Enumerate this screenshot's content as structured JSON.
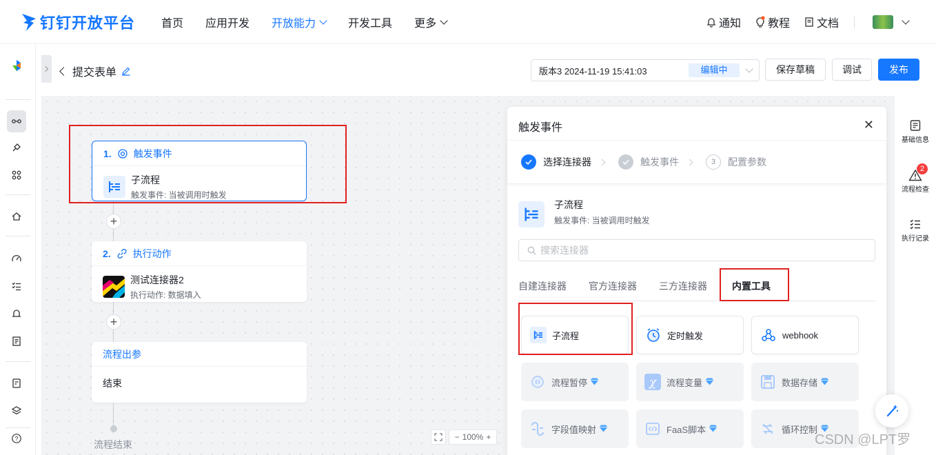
{
  "brand": {
    "name": "钉钉开放平台"
  },
  "nav": {
    "items": [
      {
        "label": "首页",
        "active": false,
        "has_menu": false
      },
      {
        "label": "应用开发",
        "active": false,
        "has_menu": false
      },
      {
        "label": "开放能力",
        "active": true,
        "has_menu": true
      },
      {
        "label": "开发工具",
        "active": false,
        "has_menu": false
      },
      {
        "label": "更多",
        "active": false,
        "has_menu": true
      }
    ],
    "notify": "通知",
    "tutorial": "教程",
    "docs": "文档"
  },
  "header": {
    "title": "提交表单",
    "version_text": "版本3 2024-11-19 15:41:03",
    "version_status": "编辑中",
    "save_draft": "保存草稿",
    "debug": "调试",
    "publish": "发布"
  },
  "flow": {
    "trigger": {
      "index": "1.",
      "label": "触发事件",
      "title": "子流程",
      "sub": "触发事件: 当被调用时触发"
    },
    "action": {
      "index": "2.",
      "label": "执行动作",
      "title": "测试连接器2",
      "sub": "执行动作: 数据填入"
    },
    "output": {
      "label": "流程出参",
      "end": "结束"
    },
    "flow_end": "流程结束",
    "zoom": "100%"
  },
  "drawer": {
    "title": "触发事件",
    "steps": [
      {
        "label": "选择连接器",
        "state": "done"
      },
      {
        "label": "触发事件",
        "state": "grey"
      },
      {
        "num": "3",
        "label": "配置参数",
        "state": "todo"
      }
    ],
    "selected": {
      "title": "子流程",
      "sub": "触发事件: 当被调用时触发"
    },
    "search_placeholder": "搜索连接器",
    "tabs": [
      "自建连接器",
      "官方连接器",
      "三方连接器",
      "内置工具"
    ],
    "tools": [
      {
        "label": "子流程",
        "icon": "subflow-icon",
        "enabled": true
      },
      {
        "label": "定时触发",
        "icon": "alarm-clock-icon",
        "enabled": true
      },
      {
        "label": "webhook",
        "icon": "webhook-icon",
        "enabled": true
      },
      {
        "label": "流程暂停",
        "icon": "pause-icon",
        "enabled": false
      },
      {
        "label": "流程变量",
        "icon": "variable-icon",
        "enabled": false
      },
      {
        "label": "数据存储",
        "icon": "save-icon",
        "enabled": false
      },
      {
        "label": "字段值映射",
        "icon": "mapping-icon",
        "enabled": false
      },
      {
        "label": "FaaS脚本",
        "icon": "code-icon",
        "enabled": false
      },
      {
        "label": "循环控制",
        "icon": "loop-icon",
        "enabled": false
      }
    ]
  },
  "rail": {
    "basic_info": "基础信息",
    "flow_check": "流程检查",
    "flow_check_badge": "2",
    "exec_log": "执行记录"
  },
  "watermark": "CSDN @LPT罗"
}
